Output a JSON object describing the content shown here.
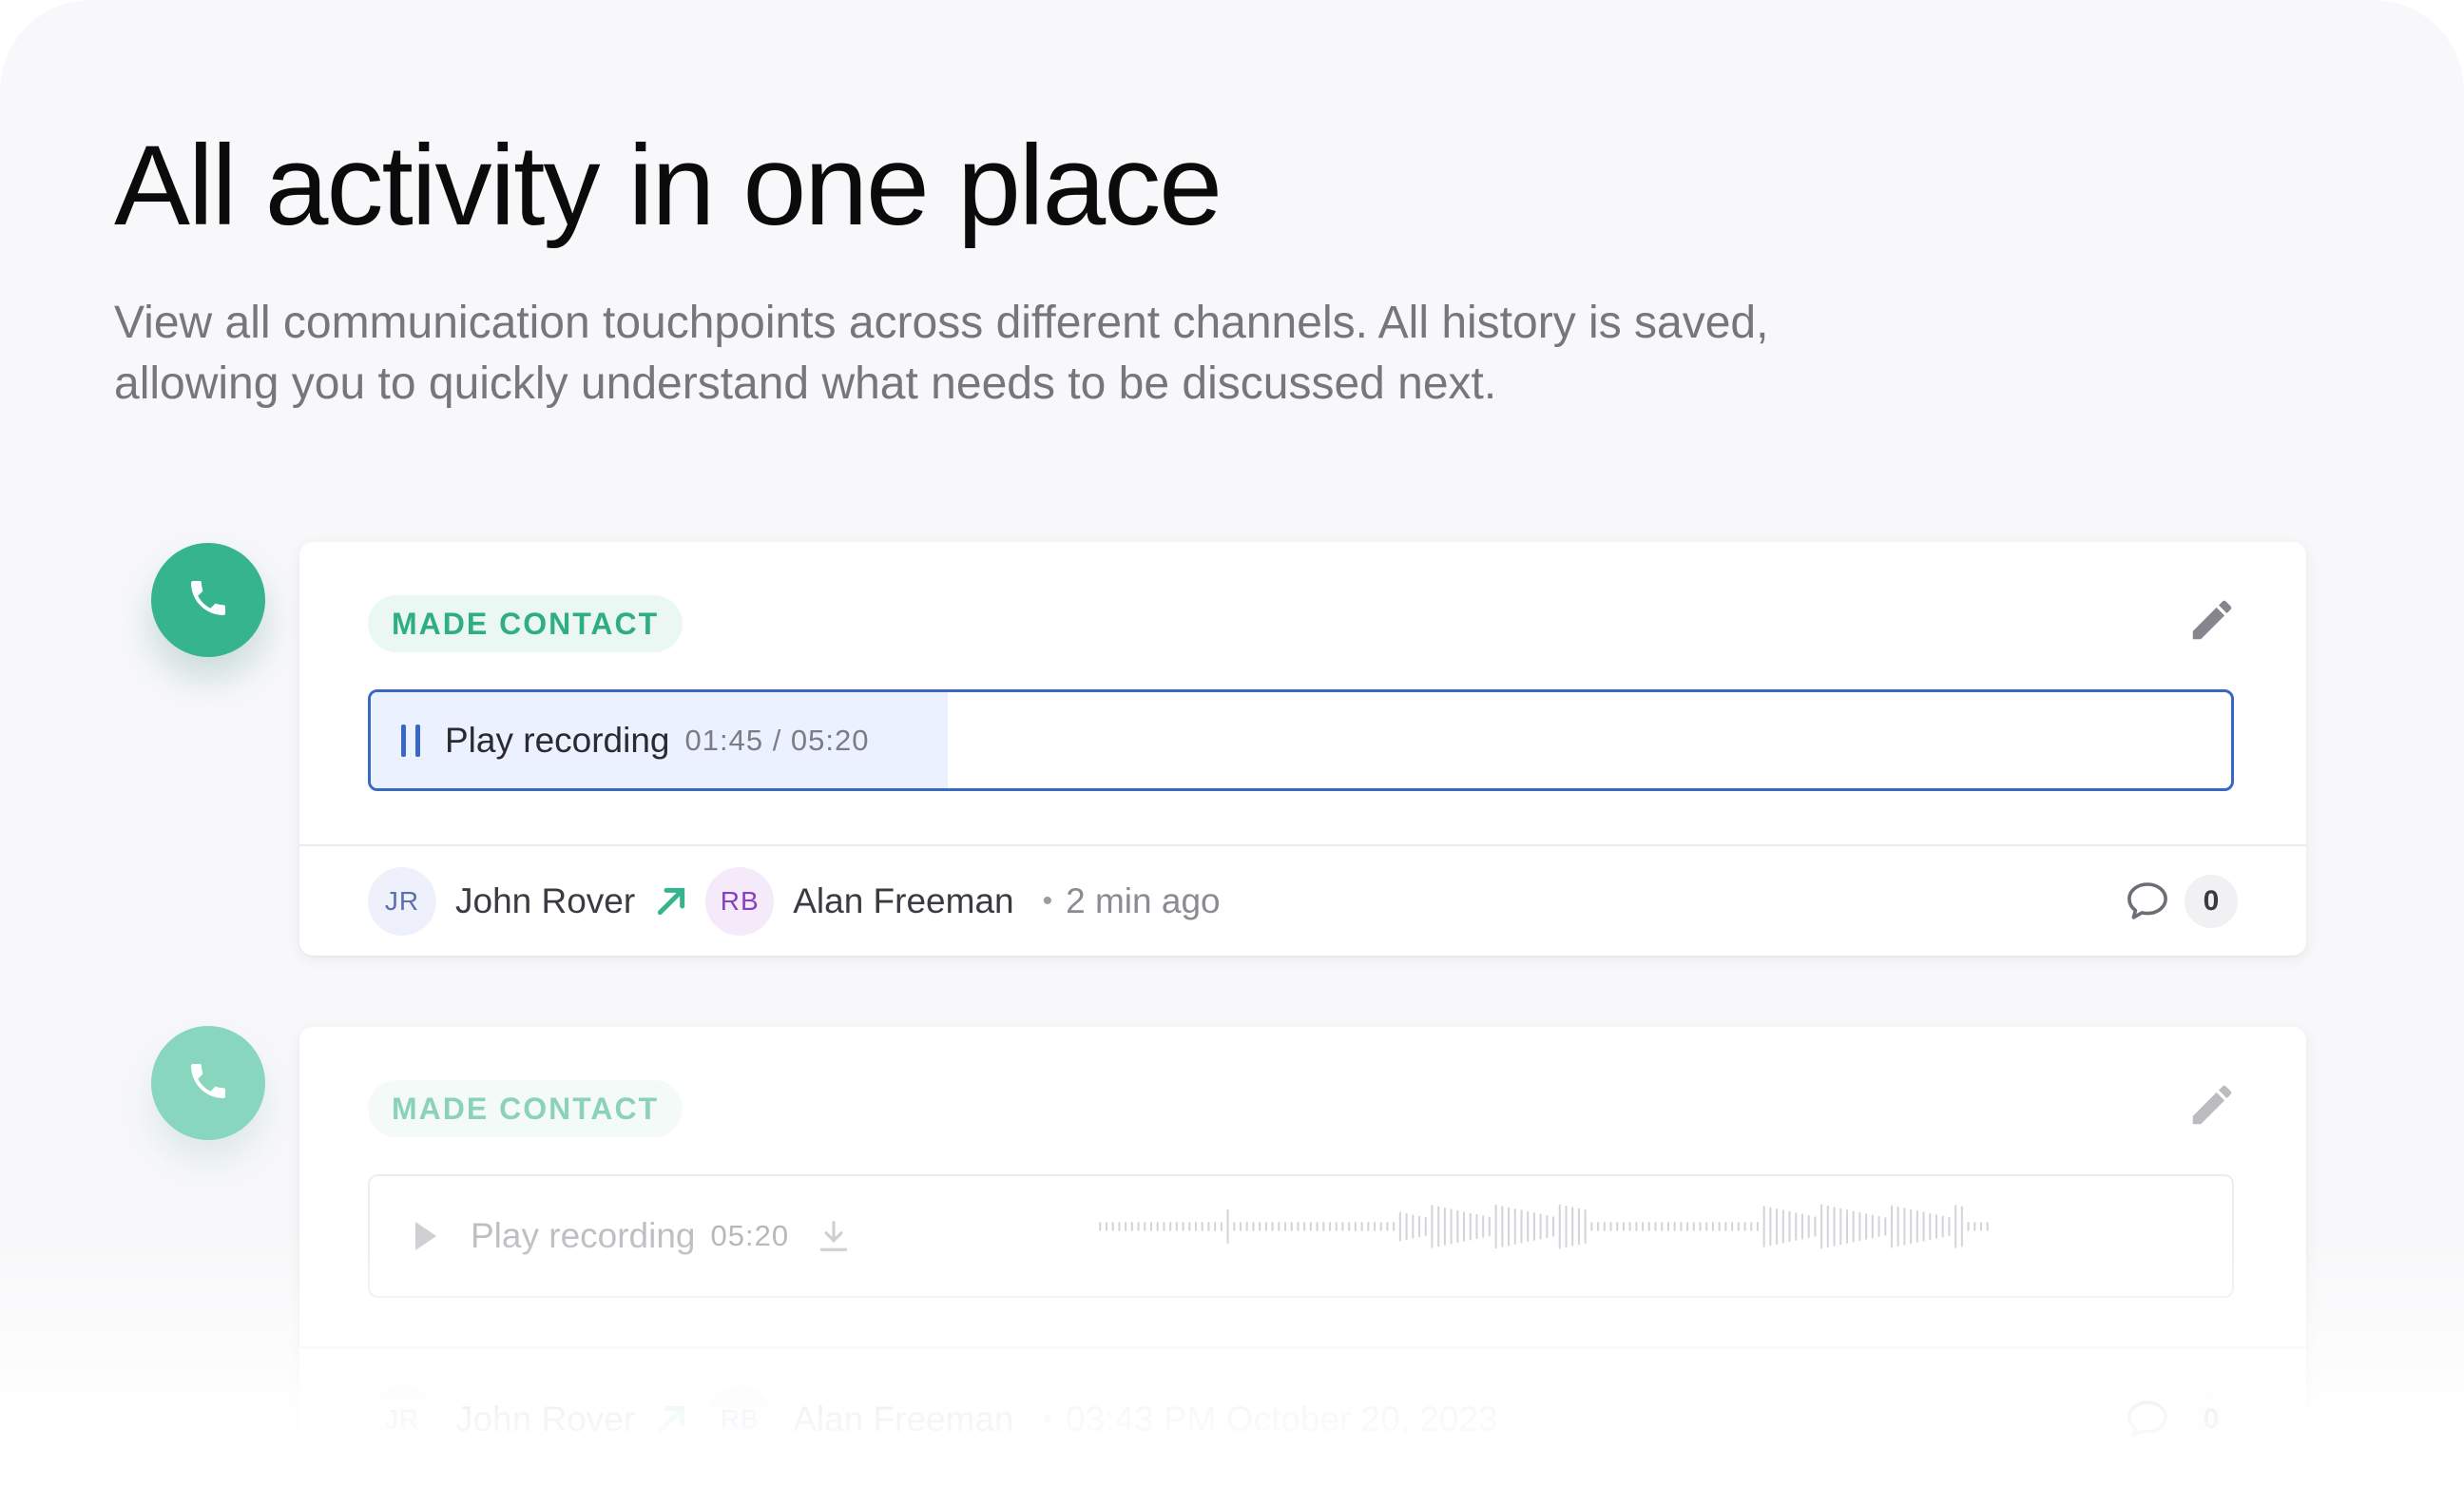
{
  "hero": {
    "title": "All activity in one place",
    "subtitle": "View all communication touchpoints across different channels. All history is saved, allowing you to quickly understand what needs to be discussed next."
  },
  "theme": {
    "accent_green": "#35b48d",
    "accent_blue": "#3967c4",
    "avatar_jr_bg": "#eef1fb",
    "avatar_rb_bg": "#f4eafa"
  },
  "activities": [
    {
      "tag": "MADE CONTACT",
      "icon": "phone-icon",
      "player": {
        "state": "playing",
        "control_icon": "pause-icon",
        "label": "Play recording",
        "time": "01:45 / 05:20",
        "progress": 0.31
      },
      "from": {
        "initials": "JR",
        "name": "John Rover"
      },
      "direction_icon": "arrow-up-right-icon",
      "to": {
        "initials": "RB",
        "name": "Alan Freeman"
      },
      "when": "2 min ago",
      "comment_count": "0"
    },
    {
      "tag": "MADE CONTACT",
      "icon": "phone-icon",
      "player": {
        "state": "paused",
        "control_icon": "play-icon",
        "label": "Play recording",
        "time": "05:20",
        "download_icon": "download-icon"
      },
      "from": {
        "initials": "JR",
        "name": "John Rover"
      },
      "direction_icon": "arrow-up-right-icon",
      "to": {
        "initials": "RB",
        "name": "Alan Freeman"
      },
      "when": "03:43 PM October 20, 2023",
      "comment_count": "0"
    }
  ]
}
